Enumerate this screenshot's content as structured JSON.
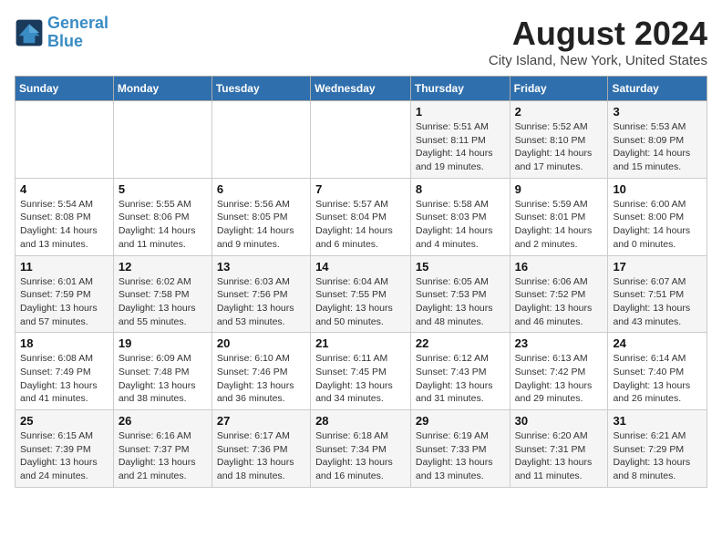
{
  "header": {
    "logo_line1": "General",
    "logo_line2": "Blue",
    "title": "August 2024",
    "subtitle": "City Island, New York, United States"
  },
  "weekdays": [
    "Sunday",
    "Monday",
    "Tuesday",
    "Wednesday",
    "Thursday",
    "Friday",
    "Saturday"
  ],
  "weeks": [
    [
      {
        "day": "",
        "info": ""
      },
      {
        "day": "",
        "info": ""
      },
      {
        "day": "",
        "info": ""
      },
      {
        "day": "",
        "info": ""
      },
      {
        "day": "1",
        "info": "Sunrise: 5:51 AM\nSunset: 8:11 PM\nDaylight: 14 hours\nand 19 minutes."
      },
      {
        "day": "2",
        "info": "Sunrise: 5:52 AM\nSunset: 8:10 PM\nDaylight: 14 hours\nand 17 minutes."
      },
      {
        "day": "3",
        "info": "Sunrise: 5:53 AM\nSunset: 8:09 PM\nDaylight: 14 hours\nand 15 minutes."
      }
    ],
    [
      {
        "day": "4",
        "info": "Sunrise: 5:54 AM\nSunset: 8:08 PM\nDaylight: 14 hours\nand 13 minutes."
      },
      {
        "day": "5",
        "info": "Sunrise: 5:55 AM\nSunset: 8:06 PM\nDaylight: 14 hours\nand 11 minutes."
      },
      {
        "day": "6",
        "info": "Sunrise: 5:56 AM\nSunset: 8:05 PM\nDaylight: 14 hours\nand 9 minutes."
      },
      {
        "day": "7",
        "info": "Sunrise: 5:57 AM\nSunset: 8:04 PM\nDaylight: 14 hours\nand 6 minutes."
      },
      {
        "day": "8",
        "info": "Sunrise: 5:58 AM\nSunset: 8:03 PM\nDaylight: 14 hours\nand 4 minutes."
      },
      {
        "day": "9",
        "info": "Sunrise: 5:59 AM\nSunset: 8:01 PM\nDaylight: 14 hours\nand 2 minutes."
      },
      {
        "day": "10",
        "info": "Sunrise: 6:00 AM\nSunset: 8:00 PM\nDaylight: 14 hours\nand 0 minutes."
      }
    ],
    [
      {
        "day": "11",
        "info": "Sunrise: 6:01 AM\nSunset: 7:59 PM\nDaylight: 13 hours\nand 57 minutes."
      },
      {
        "day": "12",
        "info": "Sunrise: 6:02 AM\nSunset: 7:58 PM\nDaylight: 13 hours\nand 55 minutes."
      },
      {
        "day": "13",
        "info": "Sunrise: 6:03 AM\nSunset: 7:56 PM\nDaylight: 13 hours\nand 53 minutes."
      },
      {
        "day": "14",
        "info": "Sunrise: 6:04 AM\nSunset: 7:55 PM\nDaylight: 13 hours\nand 50 minutes."
      },
      {
        "day": "15",
        "info": "Sunrise: 6:05 AM\nSunset: 7:53 PM\nDaylight: 13 hours\nand 48 minutes."
      },
      {
        "day": "16",
        "info": "Sunrise: 6:06 AM\nSunset: 7:52 PM\nDaylight: 13 hours\nand 46 minutes."
      },
      {
        "day": "17",
        "info": "Sunrise: 6:07 AM\nSunset: 7:51 PM\nDaylight: 13 hours\nand 43 minutes."
      }
    ],
    [
      {
        "day": "18",
        "info": "Sunrise: 6:08 AM\nSunset: 7:49 PM\nDaylight: 13 hours\nand 41 minutes."
      },
      {
        "day": "19",
        "info": "Sunrise: 6:09 AM\nSunset: 7:48 PM\nDaylight: 13 hours\nand 38 minutes."
      },
      {
        "day": "20",
        "info": "Sunrise: 6:10 AM\nSunset: 7:46 PM\nDaylight: 13 hours\nand 36 minutes."
      },
      {
        "day": "21",
        "info": "Sunrise: 6:11 AM\nSunset: 7:45 PM\nDaylight: 13 hours\nand 34 minutes."
      },
      {
        "day": "22",
        "info": "Sunrise: 6:12 AM\nSunset: 7:43 PM\nDaylight: 13 hours\nand 31 minutes."
      },
      {
        "day": "23",
        "info": "Sunrise: 6:13 AM\nSunset: 7:42 PM\nDaylight: 13 hours\nand 29 minutes."
      },
      {
        "day": "24",
        "info": "Sunrise: 6:14 AM\nSunset: 7:40 PM\nDaylight: 13 hours\nand 26 minutes."
      }
    ],
    [
      {
        "day": "25",
        "info": "Sunrise: 6:15 AM\nSunset: 7:39 PM\nDaylight: 13 hours\nand 24 minutes."
      },
      {
        "day": "26",
        "info": "Sunrise: 6:16 AM\nSunset: 7:37 PM\nDaylight: 13 hours\nand 21 minutes."
      },
      {
        "day": "27",
        "info": "Sunrise: 6:17 AM\nSunset: 7:36 PM\nDaylight: 13 hours\nand 18 minutes."
      },
      {
        "day": "28",
        "info": "Sunrise: 6:18 AM\nSunset: 7:34 PM\nDaylight: 13 hours\nand 16 minutes."
      },
      {
        "day": "29",
        "info": "Sunrise: 6:19 AM\nSunset: 7:33 PM\nDaylight: 13 hours\nand 13 minutes."
      },
      {
        "day": "30",
        "info": "Sunrise: 6:20 AM\nSunset: 7:31 PM\nDaylight: 13 hours\nand 11 minutes."
      },
      {
        "day": "31",
        "info": "Sunrise: 6:21 AM\nSunset: 7:29 PM\nDaylight: 13 hours\nand 8 minutes."
      }
    ]
  ]
}
